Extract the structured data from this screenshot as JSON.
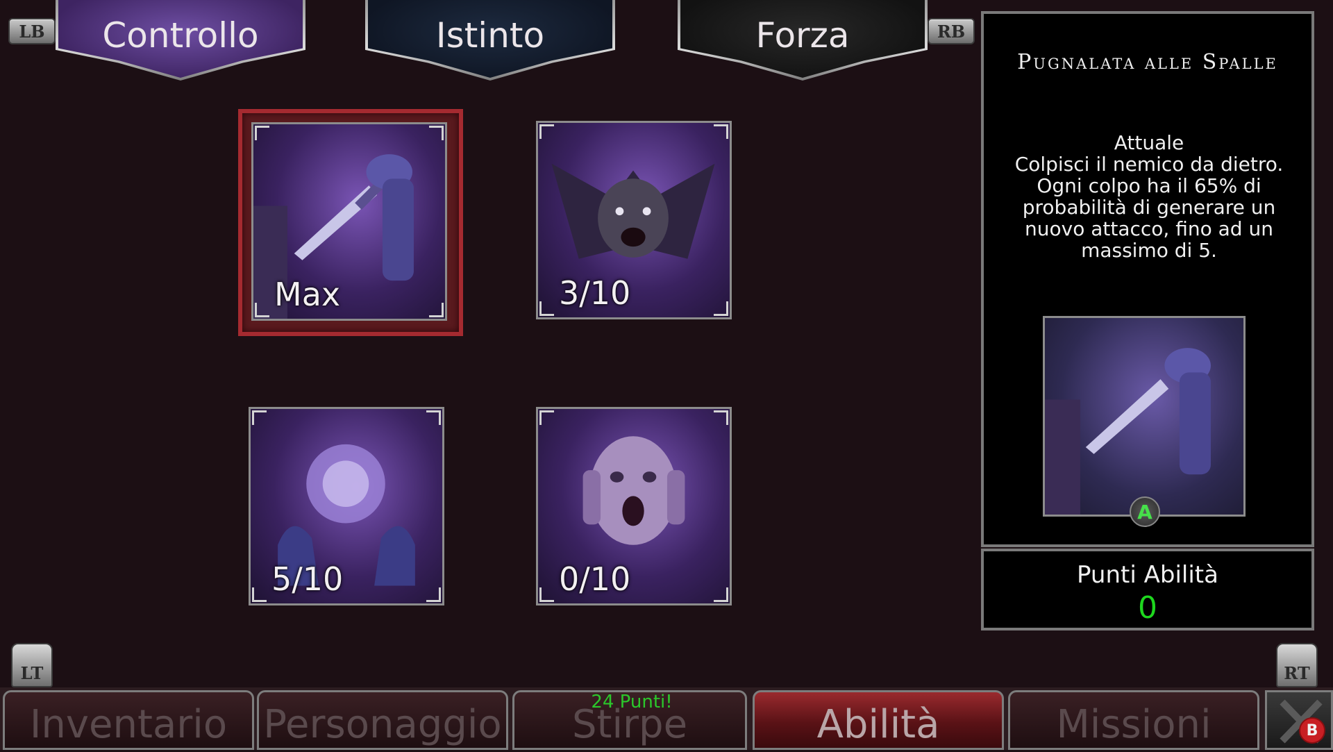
{
  "hints": {
    "lb": "LB",
    "rb": "RB",
    "lt": "LT",
    "rt": "RT"
  },
  "tabs": [
    {
      "label": "Controllo",
      "active": true
    },
    {
      "label": "Istinto",
      "active": false
    },
    {
      "label": "Forza",
      "active": false
    }
  ],
  "skills": [
    {
      "level": "Max",
      "icon": "dagger-icon",
      "selected": true
    },
    {
      "level": "3/10",
      "icon": "bat-icon",
      "selected": false
    },
    {
      "level": "5/10",
      "icon": "orb-icon",
      "selected": false
    },
    {
      "level": "0/10",
      "icon": "scream-icon",
      "selected": false
    }
  ],
  "detail": {
    "title": "Pugnalata alle Spalle",
    "current_label": "Attuale",
    "description": "Colpisci il nemico da dietro. Ogni colpo ha il 65% di probabilità di generare un nuovo attacco, fino ad un massimo di 5.",
    "confirm_button": "A"
  },
  "points": {
    "label": "Punti Abilità",
    "value": "0"
  },
  "nav": {
    "items": [
      "Inventario",
      "Personaggio",
      "Stirpe",
      "Abilità",
      "Missioni"
    ],
    "active": "Abilità",
    "badge": "24 Punti!",
    "close_hint": "B"
  },
  "colors": {
    "accent_green": "#1ed71e",
    "active_tab": "#5a3a8a",
    "selected_frame": "#a52a30"
  }
}
